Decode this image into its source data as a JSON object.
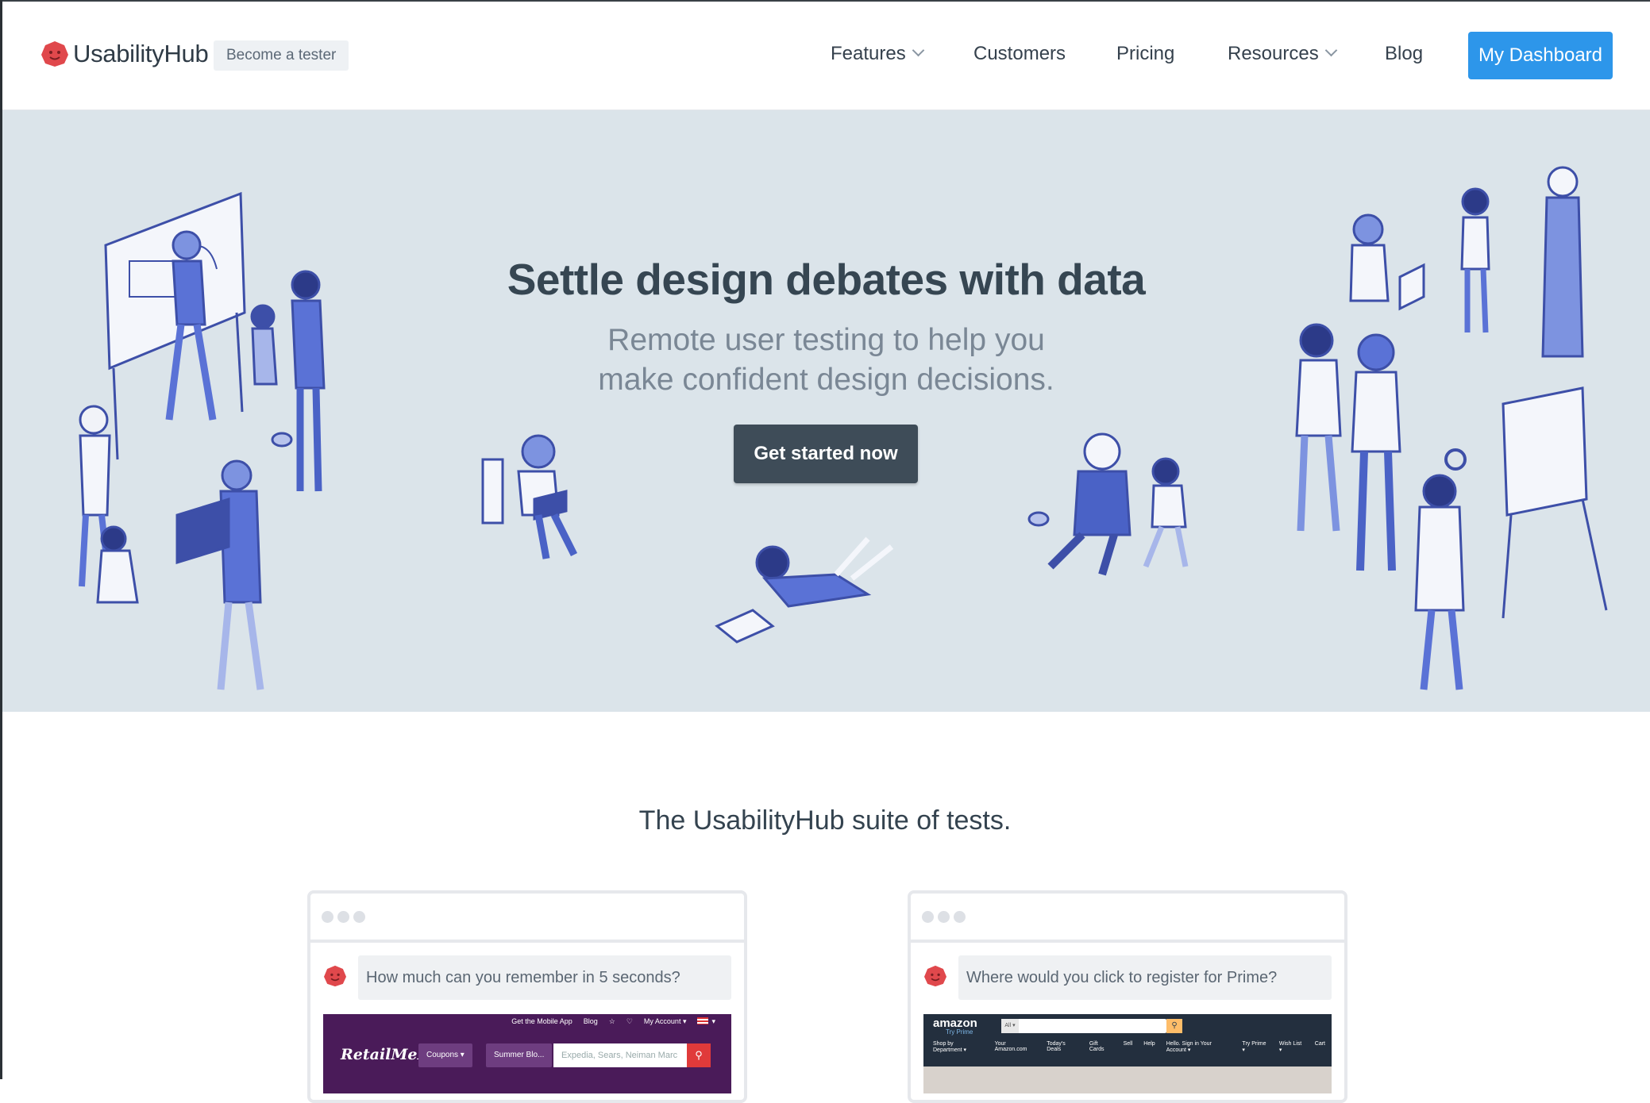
{
  "header": {
    "brand": "UsabilityHub",
    "tester_badge": "Become a tester",
    "nav": [
      {
        "label": "Features"
      },
      {
        "label": "Customers"
      },
      {
        "label": "Pricing"
      },
      {
        "label": "Resources"
      },
      {
        "label": "Blog"
      }
    ],
    "dashboard_button": "My Dashboard"
  },
  "hero": {
    "title": "Settle design debates with data",
    "subtitle_line1": "Remote user testing to help you",
    "subtitle_line2": "make confident design decisions.",
    "cta": "Get started now"
  },
  "suite": {
    "title": "The UsabilityHub suite of tests.",
    "cards": [
      {
        "question": "How much can you remember in 5 seconds?",
        "screenshot": {
          "top_links": [
            "Get the Mobile App",
            "Blog",
            "☆",
            "♡",
            "My Account ▾",
            "▾"
          ],
          "logo": "RetailMeNot",
          "buttons": [
            "Coupons ▾",
            "Summer Blo..."
          ],
          "search_placeholder": "Expedia, Sears, Neiman Marc"
        }
      },
      {
        "question": "Where would you click to register for Prime?",
        "screenshot": {
          "logo": "amazon",
          "logo_sub": "Try Prime",
          "search_scope": "All ▾",
          "nav": [
            "Shop by Department ▾",
            "Your Amazon.com",
            "Today's Deals",
            "Gift Cards",
            "Sell",
            "Help",
            "Hello. Sign in Your Account ▾",
            "Try Prime ▾",
            "Wish List ▾",
            "Cart"
          ]
        }
      }
    ]
  },
  "colors": {
    "brand_red": "#e0484c",
    "primary_blue": "#2d96ea",
    "hero_bg": "#dbe4ea",
    "cta_bg": "#3e4c58",
    "illustration_blue": "#5a72d6"
  }
}
